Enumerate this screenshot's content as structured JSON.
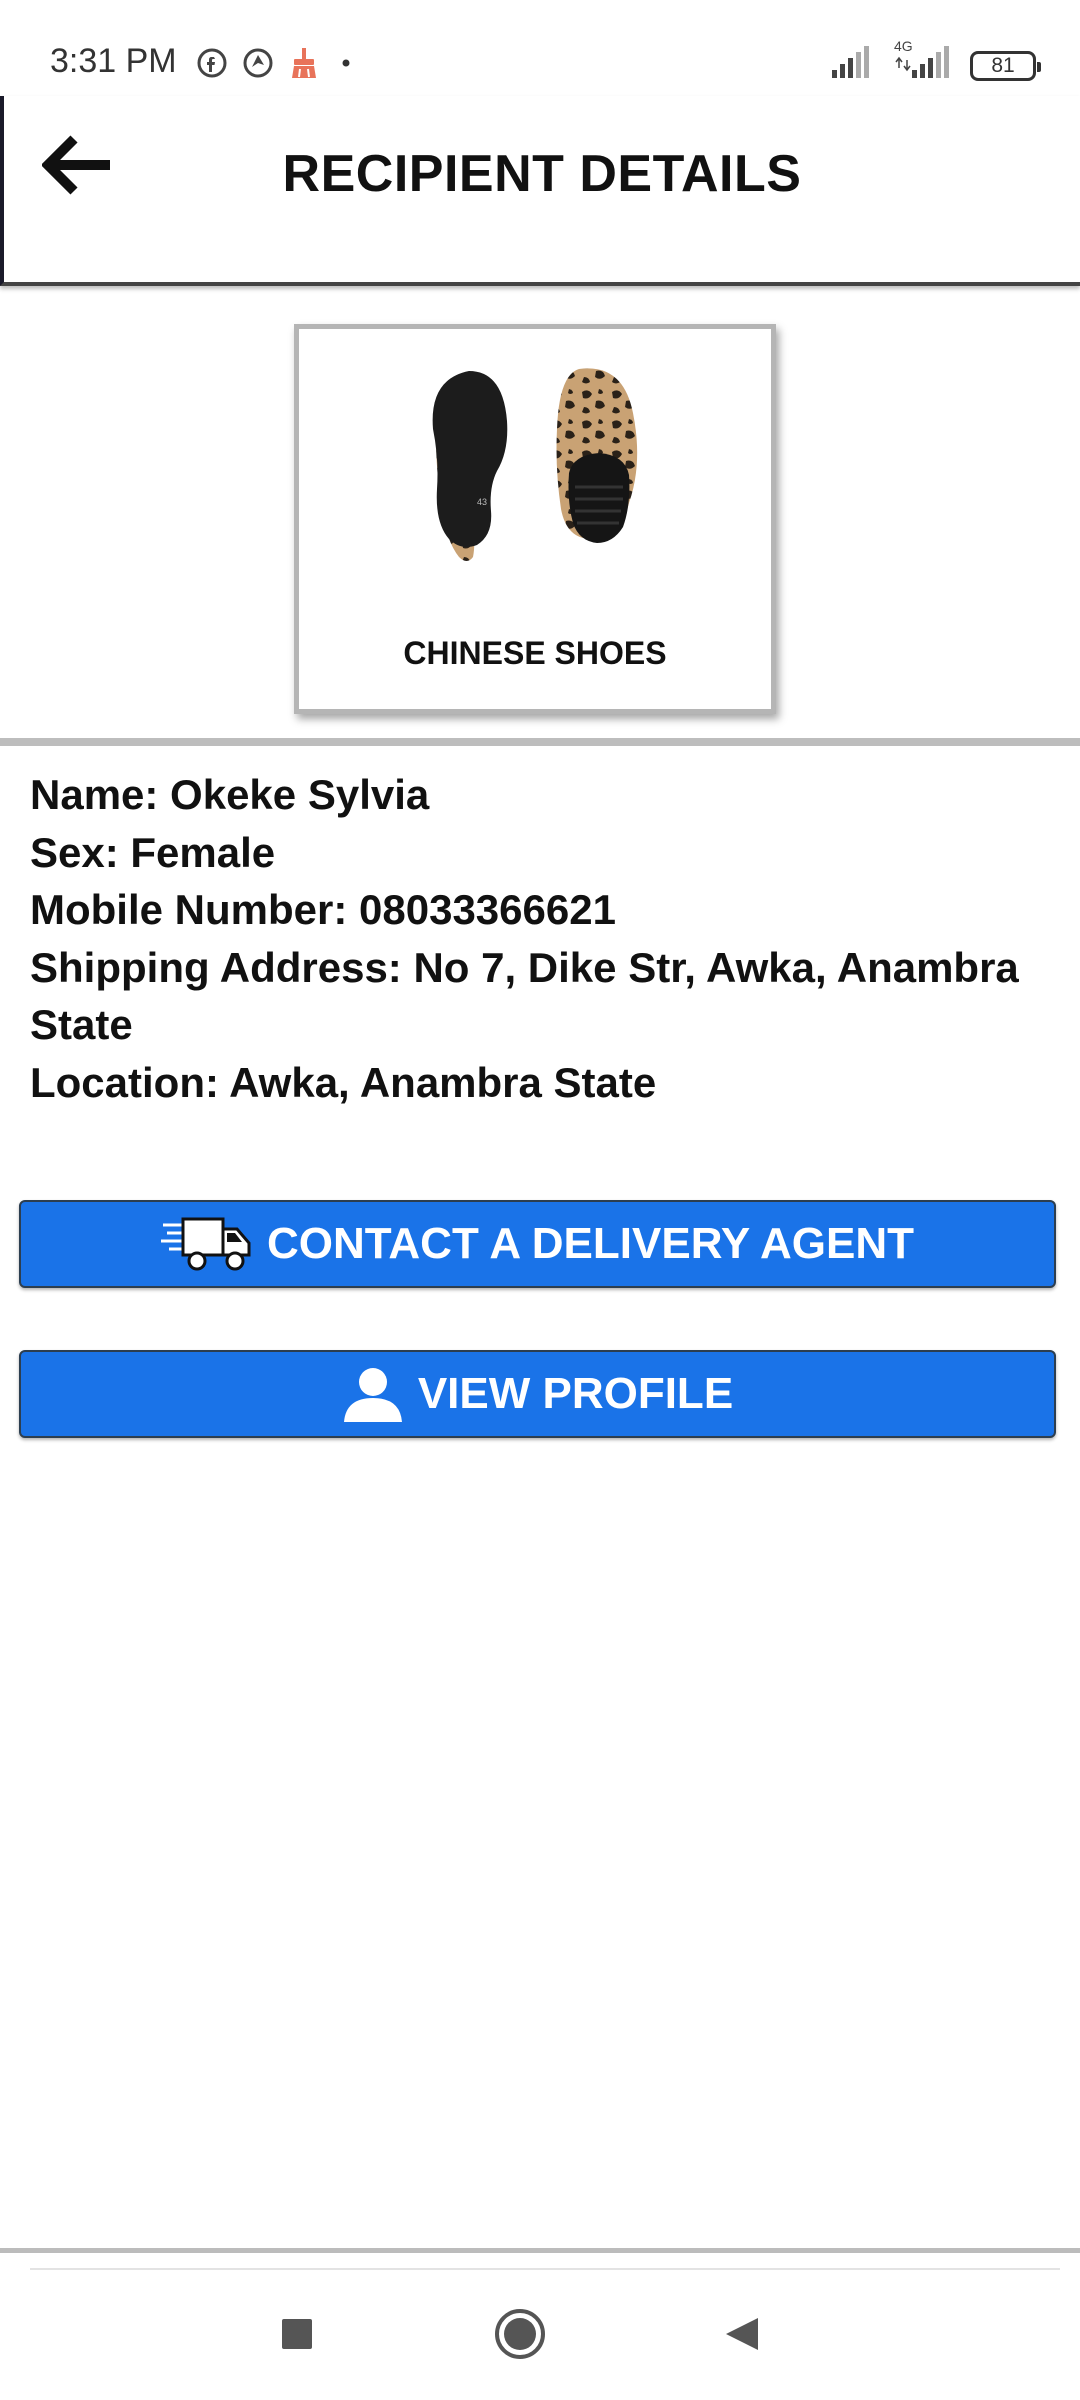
{
  "status_bar": {
    "time": "3:31 PM",
    "network_type": "4G",
    "battery_level": "81",
    "icons_left": [
      "facebook-icon",
      "browser-icon",
      "cleaner-icon",
      "notification-dot-icon"
    ],
    "icons_right": [
      "signal-icon",
      "signal-4g-icon",
      "battery-icon"
    ]
  },
  "header": {
    "title": "RECIPIENT DETAILS",
    "back_icon": "back-arrow-icon"
  },
  "product": {
    "name": "CHINESE SHOES",
    "image": "shoes-image",
    "colors": {
      "leopard_base": "#c9a274",
      "leopard_spot": "#2a2118",
      "sole": "#1c1c1c"
    }
  },
  "recipient": {
    "name_line": "Name: Okeke Sylvia",
    "sex_line": "Sex: Female",
    "mobile_line": "Mobile Number: 08033366621",
    "address_line": "Shipping Address: No 7, Dike Str, Awka, Anambra State",
    "location_line": "Location: Awka, Anambra State"
  },
  "actions": {
    "contact_delivery_label": "CONTACT A DELIVERY AGENT",
    "contact_delivery_icon": "delivery-truck-icon",
    "view_profile_label": "VIEW PROFILE",
    "view_profile_icon": "user-icon"
  },
  "nav_bar": {
    "items": [
      "recents-square-icon",
      "home-circle-icon",
      "back-triangle-icon"
    ]
  },
  "colors": {
    "button_blue": "#1a73e8",
    "text": "#111111",
    "divider": "#bdbdbd"
  }
}
